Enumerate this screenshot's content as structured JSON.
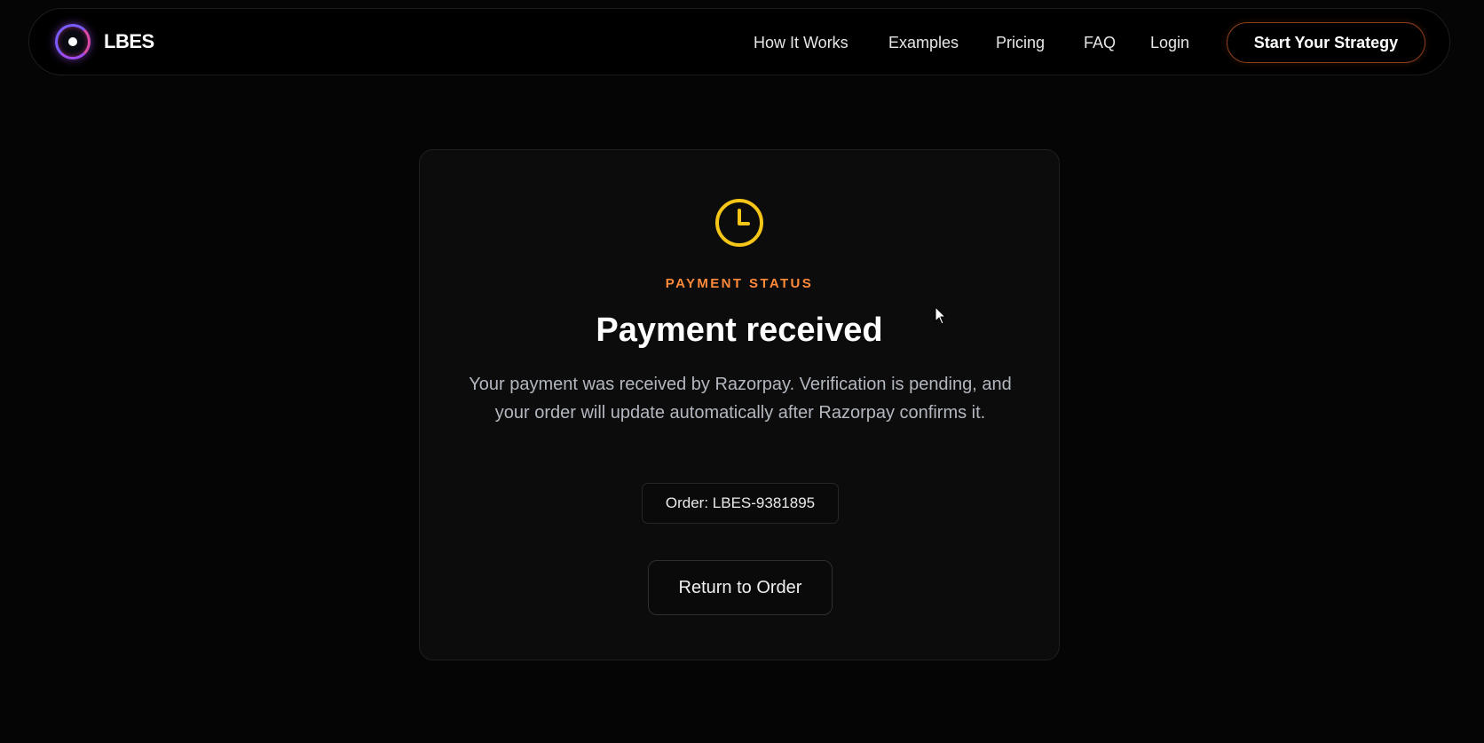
{
  "header": {
    "brand_name": "LBES",
    "nav": {
      "how_it_works": "How It Works",
      "examples": "Examples",
      "pricing": "Pricing",
      "faq": "FAQ",
      "login": "Login"
    },
    "cta_label": "Start Your Strategy"
  },
  "status_card": {
    "icon": "clock-icon",
    "eyebrow": "PAYMENT STATUS",
    "title": "Payment received",
    "description": "Your payment was received by Razorpay. Verification is pending, and your order will update automatically after Razorpay confirms it.",
    "order_badge": "Order: LBES-9381895",
    "return_button": "Return to Order"
  },
  "colors": {
    "background": "#050505",
    "card": "#0c0c0c",
    "accent_orange": "#ff8a3a",
    "icon_yellow": "#f5c518",
    "logo_ring": "#7b5cff"
  }
}
